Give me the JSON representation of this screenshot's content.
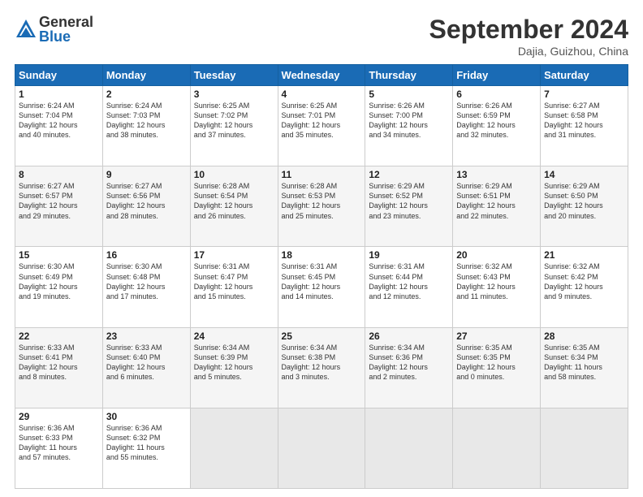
{
  "header": {
    "logo_general": "General",
    "logo_blue": "Blue",
    "month_title": "September 2024",
    "location": "Dajia, Guizhou, China"
  },
  "days_of_week": [
    "Sunday",
    "Monday",
    "Tuesday",
    "Wednesday",
    "Thursday",
    "Friday",
    "Saturday"
  ],
  "weeks": [
    [
      {
        "day": "1",
        "info": "Sunrise: 6:24 AM\nSunset: 7:04 PM\nDaylight: 12 hours\nand 40 minutes."
      },
      {
        "day": "2",
        "info": "Sunrise: 6:24 AM\nSunset: 7:03 PM\nDaylight: 12 hours\nand 38 minutes."
      },
      {
        "day": "3",
        "info": "Sunrise: 6:25 AM\nSunset: 7:02 PM\nDaylight: 12 hours\nand 37 minutes."
      },
      {
        "day": "4",
        "info": "Sunrise: 6:25 AM\nSunset: 7:01 PM\nDaylight: 12 hours\nand 35 minutes."
      },
      {
        "day": "5",
        "info": "Sunrise: 6:26 AM\nSunset: 7:00 PM\nDaylight: 12 hours\nand 34 minutes."
      },
      {
        "day": "6",
        "info": "Sunrise: 6:26 AM\nSunset: 6:59 PM\nDaylight: 12 hours\nand 32 minutes."
      },
      {
        "day": "7",
        "info": "Sunrise: 6:27 AM\nSunset: 6:58 PM\nDaylight: 12 hours\nand 31 minutes."
      }
    ],
    [
      {
        "day": "8",
        "info": "Sunrise: 6:27 AM\nSunset: 6:57 PM\nDaylight: 12 hours\nand 29 minutes."
      },
      {
        "day": "9",
        "info": "Sunrise: 6:27 AM\nSunset: 6:56 PM\nDaylight: 12 hours\nand 28 minutes."
      },
      {
        "day": "10",
        "info": "Sunrise: 6:28 AM\nSunset: 6:54 PM\nDaylight: 12 hours\nand 26 minutes."
      },
      {
        "day": "11",
        "info": "Sunrise: 6:28 AM\nSunset: 6:53 PM\nDaylight: 12 hours\nand 25 minutes."
      },
      {
        "day": "12",
        "info": "Sunrise: 6:29 AM\nSunset: 6:52 PM\nDaylight: 12 hours\nand 23 minutes."
      },
      {
        "day": "13",
        "info": "Sunrise: 6:29 AM\nSunset: 6:51 PM\nDaylight: 12 hours\nand 22 minutes."
      },
      {
        "day": "14",
        "info": "Sunrise: 6:29 AM\nSunset: 6:50 PM\nDaylight: 12 hours\nand 20 minutes."
      }
    ],
    [
      {
        "day": "15",
        "info": "Sunrise: 6:30 AM\nSunset: 6:49 PM\nDaylight: 12 hours\nand 19 minutes."
      },
      {
        "day": "16",
        "info": "Sunrise: 6:30 AM\nSunset: 6:48 PM\nDaylight: 12 hours\nand 17 minutes."
      },
      {
        "day": "17",
        "info": "Sunrise: 6:31 AM\nSunset: 6:47 PM\nDaylight: 12 hours\nand 15 minutes."
      },
      {
        "day": "18",
        "info": "Sunrise: 6:31 AM\nSunset: 6:45 PM\nDaylight: 12 hours\nand 14 minutes."
      },
      {
        "day": "19",
        "info": "Sunrise: 6:31 AM\nSunset: 6:44 PM\nDaylight: 12 hours\nand 12 minutes."
      },
      {
        "day": "20",
        "info": "Sunrise: 6:32 AM\nSunset: 6:43 PM\nDaylight: 12 hours\nand 11 minutes."
      },
      {
        "day": "21",
        "info": "Sunrise: 6:32 AM\nSunset: 6:42 PM\nDaylight: 12 hours\nand 9 minutes."
      }
    ],
    [
      {
        "day": "22",
        "info": "Sunrise: 6:33 AM\nSunset: 6:41 PM\nDaylight: 12 hours\nand 8 minutes."
      },
      {
        "day": "23",
        "info": "Sunrise: 6:33 AM\nSunset: 6:40 PM\nDaylight: 12 hours\nand 6 minutes."
      },
      {
        "day": "24",
        "info": "Sunrise: 6:34 AM\nSunset: 6:39 PM\nDaylight: 12 hours\nand 5 minutes."
      },
      {
        "day": "25",
        "info": "Sunrise: 6:34 AM\nSunset: 6:38 PM\nDaylight: 12 hours\nand 3 minutes."
      },
      {
        "day": "26",
        "info": "Sunrise: 6:34 AM\nSunset: 6:36 PM\nDaylight: 12 hours\nand 2 minutes."
      },
      {
        "day": "27",
        "info": "Sunrise: 6:35 AM\nSunset: 6:35 PM\nDaylight: 12 hours\nand 0 minutes."
      },
      {
        "day": "28",
        "info": "Sunrise: 6:35 AM\nSunset: 6:34 PM\nDaylight: 11 hours\nand 58 minutes."
      }
    ],
    [
      {
        "day": "29",
        "info": "Sunrise: 6:36 AM\nSunset: 6:33 PM\nDaylight: 11 hours\nand 57 minutes."
      },
      {
        "day": "30",
        "info": "Sunrise: 6:36 AM\nSunset: 6:32 PM\nDaylight: 11 hours\nand 55 minutes."
      },
      {
        "day": "",
        "info": ""
      },
      {
        "day": "",
        "info": ""
      },
      {
        "day": "",
        "info": ""
      },
      {
        "day": "",
        "info": ""
      },
      {
        "day": "",
        "info": ""
      }
    ]
  ]
}
